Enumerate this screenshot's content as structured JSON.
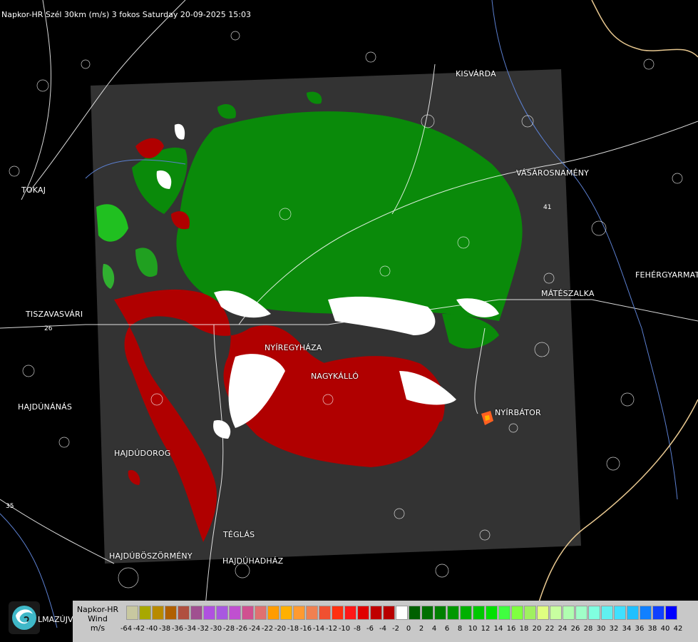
{
  "header": "Napkor-HR Szél 30km (m/s) 3 fokos Saturday 20-09-2025 15:03",
  "cities": [
    {
      "name": "KISVÁRDA"
    },
    {
      "name": "VÁSÁROSNAMÉNY"
    },
    {
      "name": "TOKAJ"
    },
    {
      "name": "FEHÉRGYARMAT"
    },
    {
      "name": "MÁTÉSZALKA"
    },
    {
      "name": "TISZAVASVÁRI"
    },
    {
      "name": "NYÍREGYHÁZA"
    },
    {
      "name": "NAGYKÁLLÓ"
    },
    {
      "name": "HAJDÚNÁNÁS"
    },
    {
      "name": "NYÍRBÁTOR"
    },
    {
      "name": "HAJDÚDOROG"
    },
    {
      "name": "TÉGLÁS"
    },
    {
      "name": "HAJDÚBÖSZÖRMÉNY"
    },
    {
      "name": "HAJDÚHADHÁZ"
    }
  ],
  "road_numbers": [
    "26",
    "41",
    "35"
  ],
  "logo_text": "LMAZÚJVÁR",
  "legend": {
    "title_lines": [
      "Napkor-HR",
      "Wind",
      "m/s"
    ],
    "colors": [
      "#c8c8a0",
      "#a8a800",
      "#b88a00",
      "#b06000",
      "#b05040",
      "#a05090",
      "#b050e0",
      "#a858e0",
      "#c050d0",
      "#d05090",
      "#e07070",
      "#ff9c00",
      "#ffb000",
      "#ff9a30",
      "#f08050",
      "#f05030",
      "#ff3010",
      "#ff1818",
      "#e00000",
      "#c00000",
      "#b80000",
      "#ffffff",
      "#006000",
      "#007000",
      "#008000",
      "#009800",
      "#00b000",
      "#00c800",
      "#00e000",
      "#40ff40",
      "#80ff40",
      "#a0f060",
      "#e0ff80",
      "#c8ffa0",
      "#b0ffb0",
      "#a0ffc8",
      "#80ffe0",
      "#60f0f0",
      "#40e0ff",
      "#20c0ff",
      "#1080ff",
      "#1040ff",
      "#0000ff"
    ],
    "ticks": [
      "-64",
      "-42",
      "-40",
      "-38",
      "-36",
      "-34",
      "-32",
      "-30",
      "-28",
      "-26",
      "-24",
      "-22",
      "-20",
      "-18",
      "-16",
      "-14",
      "-12",
      "-10",
      "-8",
      "-6",
      "-4",
      "-2",
      "0",
      "2",
      "4",
      "6",
      "8",
      "10",
      "12",
      "14",
      "16",
      "18",
      "20",
      "22",
      "24",
      "26",
      "28",
      "30",
      "32",
      "34",
      "36",
      "38",
      "40",
      "42"
    ]
  }
}
